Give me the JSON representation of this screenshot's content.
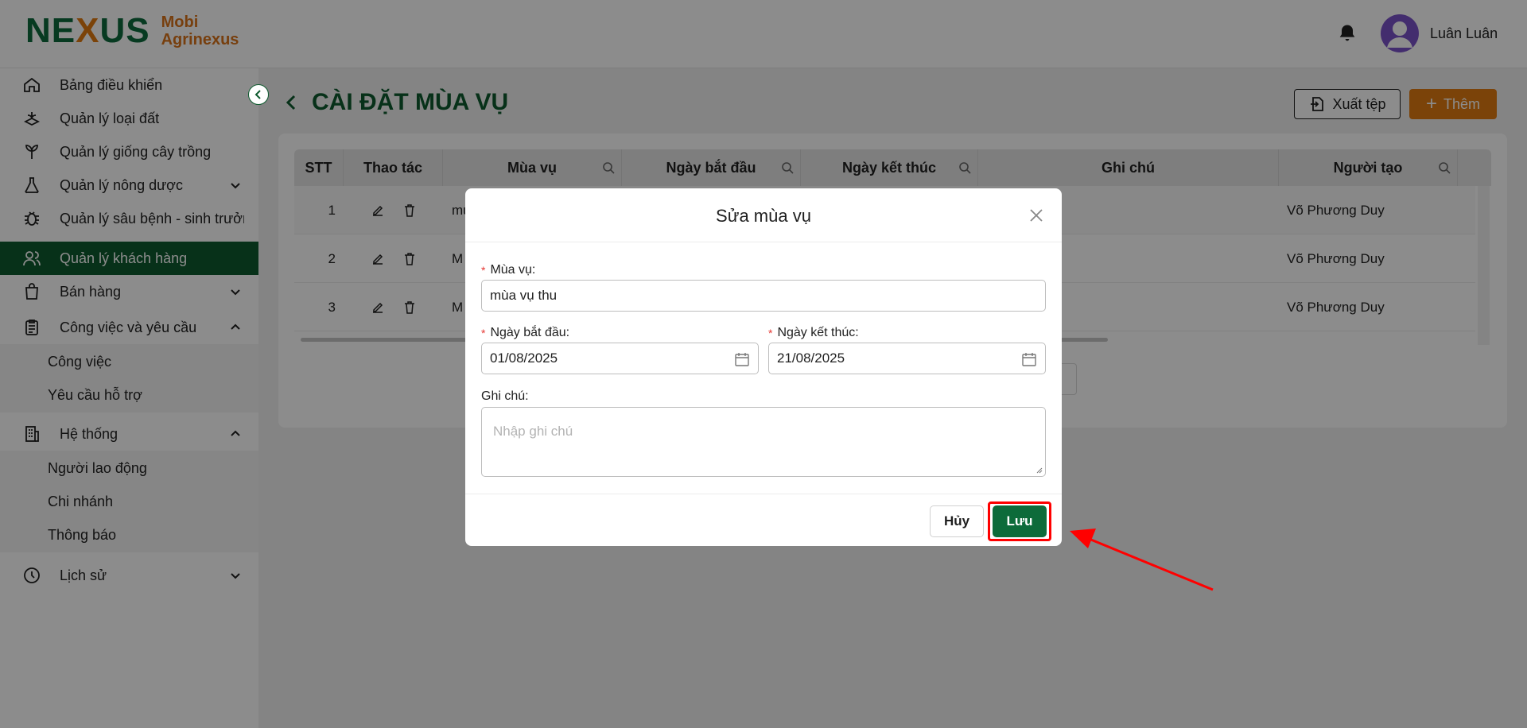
{
  "header": {
    "logo_mark_left": "NE",
    "logo_mark_x": "X",
    "logo_mark_right": "US",
    "brand_line1": "Mobi",
    "brand_line2": "Agrinexus",
    "user_name": "Luân Luân",
    "icons": [
      "bell-icon",
      "avatar-icon"
    ]
  },
  "sidebar": {
    "items": [
      {
        "label": "Bảng điều khiển",
        "icon": "home-icon"
      },
      {
        "label": "Quản lý loại đất",
        "icon": "soil-icon"
      },
      {
        "label": "Quản lý giống cây trồng",
        "icon": "plant-icon"
      },
      {
        "label": "Quản lý nông dược",
        "icon": "flask-icon",
        "chevron": "down"
      },
      {
        "label": "Quản lý sâu bệnh - sinh trưởng",
        "icon": "bug-icon"
      },
      {
        "label": "Quản lý khách hàng",
        "icon": "users-icon",
        "active": true
      },
      {
        "label": "Bán hàng",
        "icon": "bag-icon",
        "chevron": "down"
      },
      {
        "label": "Công việc và yêu cầu",
        "icon": "clipboard-icon",
        "chevron": "up"
      },
      {
        "label": "Hệ thống",
        "icon": "building-icon",
        "chevron": "up"
      },
      {
        "label": "Lịch sử",
        "icon": "history-icon",
        "chevron": "down"
      }
    ],
    "work_sub": [
      "Công việc",
      "Yêu cầu hỗ trợ"
    ],
    "system_sub": [
      "Người lao động",
      "Chi nhánh",
      "Thông báo"
    ]
  },
  "main": {
    "title": "CÀI ĐẶT MÙA VỤ",
    "export_label": "Xuất tệp",
    "add_label": "Thêm",
    "columns": [
      "STT",
      "Thao tác",
      "Mùa vụ",
      "Ngày bắt đầu",
      "Ngày kết thúc",
      "Ghi chú",
      "Người tạo"
    ],
    "rows": [
      {
        "stt": "1",
        "season": "mù",
        "creator": "Võ Phương Duy"
      },
      {
        "stt": "2",
        "season": "M",
        "creator": "Võ Phương Duy"
      },
      {
        "stt": "3",
        "season": "M",
        "creator": "Võ Phương Duy"
      }
    ]
  },
  "modal": {
    "title": "Sửa mùa vụ",
    "season_label": "Mùa vụ:",
    "season_value": "mùa vụ thu",
    "start_label": "Ngày bắt đầu:",
    "start_value": "01/08/2025",
    "end_label": "Ngày kết thúc:",
    "end_value": "21/08/2025",
    "note_label": "Ghi chú:",
    "note_placeholder": "Nhập ghi chú",
    "cancel_label": "Hủy",
    "save_label": "Lưu",
    "required_mark": "*"
  },
  "colors": {
    "brand_green": "#0d5a2e",
    "accent_orange": "#e07a12",
    "highlight_red": "#ff0000"
  }
}
